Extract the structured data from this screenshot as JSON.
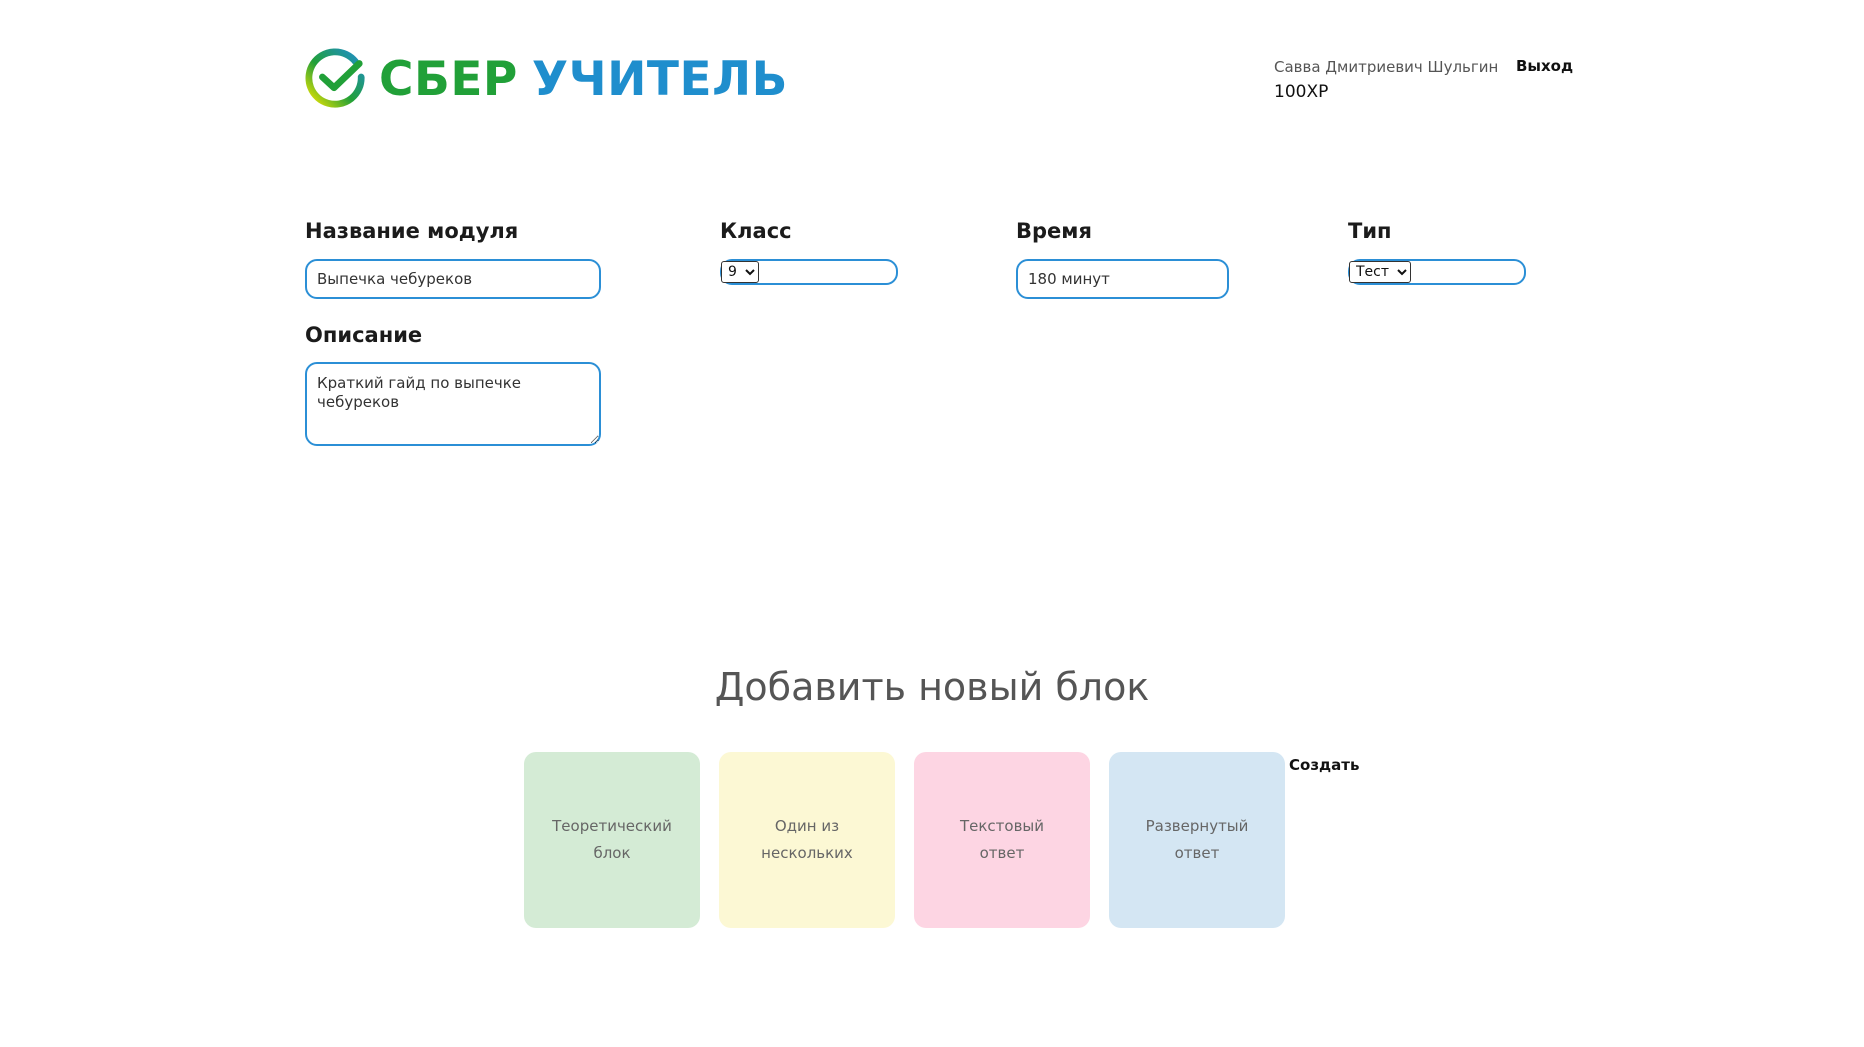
{
  "header": {
    "logo_part1": "СБЕР",
    "logo_part2": "УЧИТЕЛЬ",
    "user_name": "Савва Дмитриевич Шульгин",
    "logout_label": "Выход",
    "xp": "100XP"
  },
  "form": {
    "module_name_label": "Название модуля",
    "module_name_value": "Выпечка чебуреков",
    "description_label": "Описание",
    "description_value": "Краткий гайд по выпечке чебуреков",
    "grade_label": "Класс",
    "grade_selected": "9",
    "time_label": "Время",
    "time_value": "180 минут",
    "type_label": "Тип",
    "type_selected": "Тест"
  },
  "add_block": {
    "title": "Добавить новый блок",
    "blocks": [
      {
        "label": "Теоретический\nблок",
        "color": "#d4ebd5"
      },
      {
        "label": "Один из\nнескольких",
        "color": "#fcf8d4"
      },
      {
        "label": "Текстовый\nответ",
        "color": "#fdd5e3"
      },
      {
        "label": "Развернутый\nответ",
        "color": "#d4e6f3"
      }
    ],
    "create_label": "Создать"
  },
  "colors": {
    "brand_green": "#21a038",
    "brand_blue": "#1f8ecd",
    "input_border": "#2b8fd6"
  }
}
